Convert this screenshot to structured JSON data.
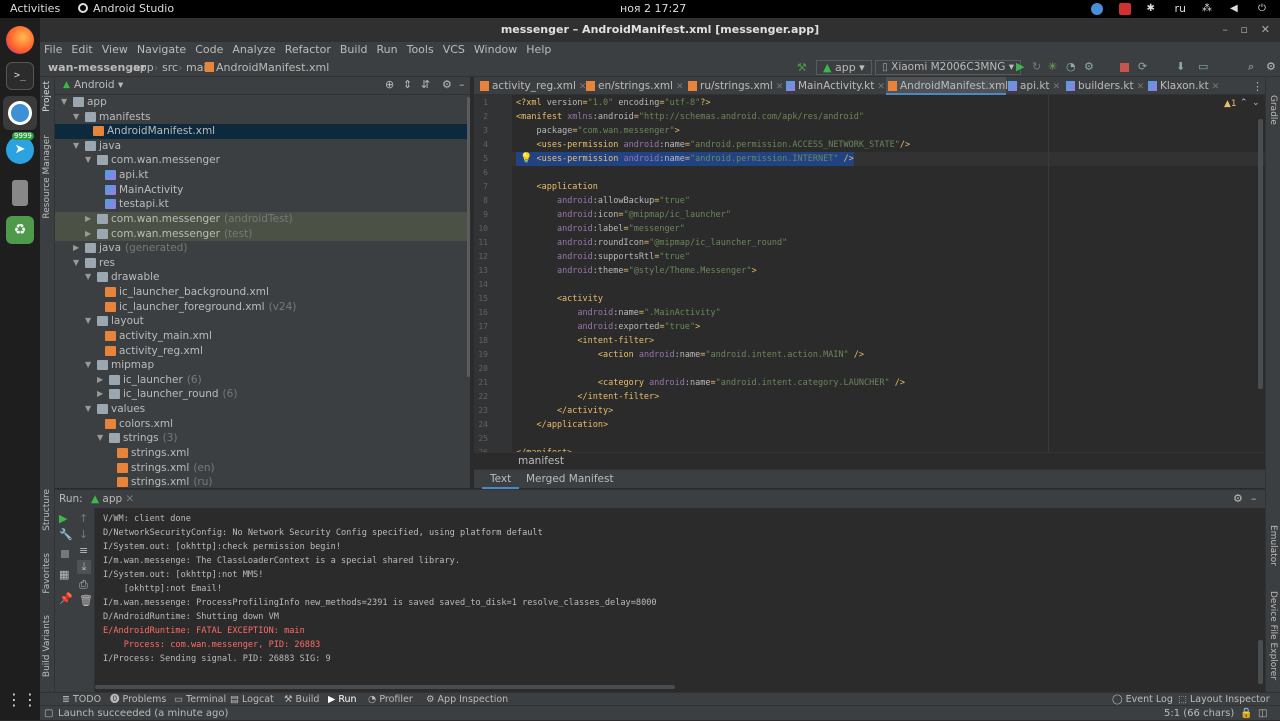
{
  "gnome": {
    "activities": "Activities",
    "app_name": "Android Studio",
    "clock": "ноя 2  17:27",
    "lang": "ru"
  },
  "window": {
    "title": "messenger – AndroidManifest.xml [messenger.app]"
  },
  "menu": [
    "File",
    "Edit",
    "View",
    "Navigate",
    "Code",
    "Analyze",
    "Refactor",
    "Build",
    "Run",
    "Tools",
    "VCS",
    "Window",
    "Help"
  ],
  "breadcrumb": [
    "wan-messenger",
    "app",
    "src",
    "main",
    "AndroidManifest.xml"
  ],
  "toolbar": {
    "run_config": "app",
    "device": "Xiaomi M2006C3MNG"
  },
  "dock": {
    "telegram_badge": "9999"
  },
  "stripes": {
    "left": [
      "Project",
      "Resource Manager",
      "Structure",
      "Favorites",
      "Build Variants"
    ],
    "right": [
      "Gradle",
      "Emulator",
      "Device File Explorer"
    ]
  },
  "project": {
    "view_label": "Android",
    "tree": [
      {
        "label": "app",
        "extra": "",
        "depth": 0,
        "kind": "folder",
        "open": true
      },
      {
        "label": "manifests",
        "extra": "",
        "depth": 1,
        "kind": "folder",
        "open": true
      },
      {
        "label": "AndroidManifest.xml",
        "extra": "",
        "depth": 2,
        "kind": "xml",
        "selected": true
      },
      {
        "label": "java",
        "extra": "",
        "depth": 1,
        "kind": "folder",
        "open": true
      },
      {
        "label": "com.wan.messenger",
        "extra": "",
        "depth": 2,
        "kind": "folder",
        "open": true
      },
      {
        "label": "api.kt",
        "extra": "",
        "depth": 3,
        "kind": "kt"
      },
      {
        "label": "MainActivity",
        "extra": "",
        "depth": 3,
        "kind": "kt"
      },
      {
        "label": "testapi.kt",
        "extra": "",
        "depth": 3,
        "kind": "kt"
      },
      {
        "label": "com.wan.messenger",
        "extra": "(androidTest)",
        "depth": 2,
        "kind": "folder",
        "closed": true,
        "hl": true
      },
      {
        "label": "com.wan.messenger",
        "extra": "(test)",
        "depth": 2,
        "kind": "folder",
        "closed": true,
        "hl": true
      },
      {
        "label": "java",
        "extra": "(generated)",
        "depth": 1,
        "kind": "folder",
        "closed": true
      },
      {
        "label": "res",
        "extra": "",
        "depth": 1,
        "kind": "folder",
        "open": true
      },
      {
        "label": "drawable",
        "extra": "",
        "depth": 2,
        "kind": "folder",
        "open": true
      },
      {
        "label": "ic_launcher_background.xml",
        "extra": "",
        "depth": 3,
        "kind": "xml"
      },
      {
        "label": "ic_launcher_foreground.xml",
        "extra": "(v24)",
        "depth": 3,
        "kind": "xml"
      },
      {
        "label": "layout",
        "extra": "",
        "depth": 2,
        "kind": "folder",
        "open": true
      },
      {
        "label": "activity_main.xml",
        "extra": "",
        "depth": 3,
        "kind": "xml"
      },
      {
        "label": "activity_reg.xml",
        "extra": "",
        "depth": 3,
        "kind": "xml"
      },
      {
        "label": "mipmap",
        "extra": "",
        "depth": 2,
        "kind": "folder",
        "open": true
      },
      {
        "label": "ic_launcher",
        "extra": "(6)",
        "depth": 3,
        "kind": "folder",
        "closed": true
      },
      {
        "label": "ic_launcher_round",
        "extra": "(6)",
        "depth": 3,
        "kind": "folder",
        "closed": true
      },
      {
        "label": "values",
        "extra": "",
        "depth": 2,
        "kind": "folder",
        "open": true
      },
      {
        "label": "colors.xml",
        "extra": "",
        "depth": 3,
        "kind": "xml"
      },
      {
        "label": "strings",
        "extra": "(3)",
        "depth": 3,
        "kind": "folder",
        "open": true
      },
      {
        "label": "strings.xml",
        "extra": "",
        "depth": 4,
        "kind": "xml"
      },
      {
        "label": "strings.xml",
        "extra": "(en)",
        "depth": 4,
        "kind": "xml"
      },
      {
        "label": "strings.xml",
        "extra": "(ru)",
        "depth": 4,
        "kind": "xml"
      }
    ]
  },
  "tabs": [
    {
      "label": "activity_reg.xml"
    },
    {
      "label": "en/strings.xml"
    },
    {
      "label": "ru/strings.xml"
    },
    {
      "label": "MainActivity.kt"
    },
    {
      "label": "AndroidManifest.xml",
      "active": true
    },
    {
      "label": "api.kt"
    },
    {
      "label": "builders.kt"
    },
    {
      "label": "Klaxon.kt"
    }
  ],
  "editor": {
    "warning_count": "1",
    "lines": [
      "<?xml version=\"1.0\" encoding=\"utf-8\"?>",
      "<manifest xmlns:android=\"http://schemas.android.com/apk/res/android\"",
      "    package=\"com.wan.messenger\">",
      "    <uses-permission android:name=\"android.permission.ACCESS_NETWORK_STATE\"/>",
      "    <uses-permission android:name=\"android.permission.INTERNET\" />",
      "",
      "    <application",
      "        android:allowBackup=\"true\"",
      "        android:icon=\"@mipmap/ic_launcher\"",
      "        android:label=\"messenger\"",
      "        android:roundIcon=\"@mipmap/ic_launcher_round\"",
      "        android:supportsRtl=\"true\"",
      "        android:theme=\"@style/Theme.Messenger\">",
      "",
      "        <activity",
      "            android:name=\".MainActivity\"",
      "            android:exported=\"true\">",
      "            <intent-filter>",
      "                <action android:name=\"android.intent.action.MAIN\" />",
      "",
      "                <category android:name=\"android.intent.category.LAUNCHER\" />",
      "            </intent-filter>",
      "        </activity>",
      "    </application>",
      "",
      "</manifest>"
    ],
    "crumb": "manifest",
    "bottom_tabs": [
      "Text",
      "Merged Manifest"
    ]
  },
  "run": {
    "label": "Run:",
    "config": "app",
    "lines": [
      {
        "t": "V/WM: client done",
        "err": false
      },
      {
        "t": "D/NetworkSecurityConfig: No Network Security Config specified, using platform default",
        "err": false
      },
      {
        "t": "I/System.out: [okhttp]:check permission begin!",
        "err": false
      },
      {
        "t": "I/m.wan.messenge: The ClassLoaderContext is a special shared library.",
        "err": false
      },
      {
        "t": "I/System.out: [okhttp]:not MMS!",
        "err": false
      },
      {
        "t": "    [okhttp]:not Email!",
        "err": false
      },
      {
        "t": "I/m.wan.messenge: ProcessProfilingInfo new_methods=2391 is saved saved_to_disk=1 resolve_classes_delay=8000",
        "err": false
      },
      {
        "t": "D/AndroidRuntime: Shutting down VM",
        "err": false
      },
      {
        "t": "E/AndroidRuntime: FATAL EXCEPTION: main",
        "err": true
      },
      {
        "t": "    Process: com.wan.messenger, PID: 26883",
        "err": true
      },
      {
        "t": "I/Process: Sending signal. PID: 26883 SIG: 9",
        "err": false
      }
    ]
  },
  "bottom_tools": [
    "TODO",
    "Problems",
    "Terminal",
    "Logcat",
    "Build",
    "Run",
    "Profiler",
    "App Inspection",
    "Event Log",
    "Layout Inspector"
  ],
  "status": {
    "message": "Launch succeeded (a minute ago)",
    "position": "5:1 (66 chars)"
  }
}
